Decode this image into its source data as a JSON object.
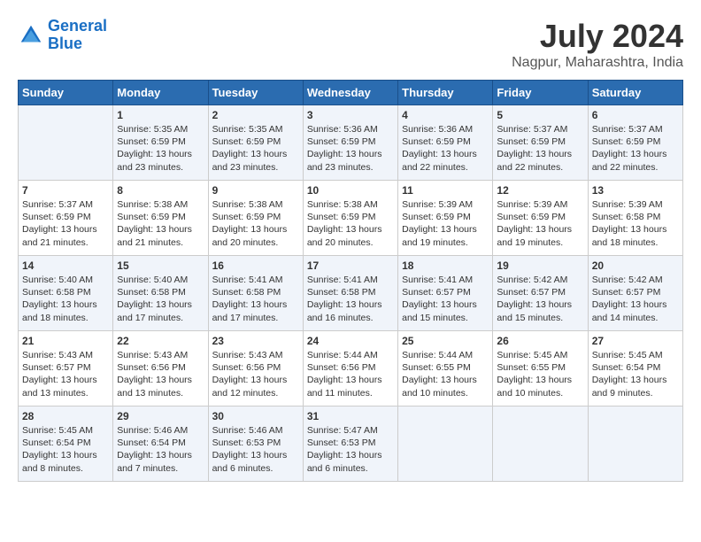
{
  "logo": {
    "line1": "General",
    "line2": "Blue"
  },
  "title": "July 2024",
  "location": "Nagpur, Maharashtra, India",
  "headers": [
    "Sunday",
    "Monday",
    "Tuesday",
    "Wednesday",
    "Thursday",
    "Friday",
    "Saturday"
  ],
  "weeks": [
    [
      {
        "day": "",
        "sunrise": "",
        "sunset": "",
        "daylight": ""
      },
      {
        "day": "1",
        "sunrise": "Sunrise: 5:35 AM",
        "sunset": "Sunset: 6:59 PM",
        "daylight": "Daylight: 13 hours and 23 minutes."
      },
      {
        "day": "2",
        "sunrise": "Sunrise: 5:35 AM",
        "sunset": "Sunset: 6:59 PM",
        "daylight": "Daylight: 13 hours and 23 minutes."
      },
      {
        "day": "3",
        "sunrise": "Sunrise: 5:36 AM",
        "sunset": "Sunset: 6:59 PM",
        "daylight": "Daylight: 13 hours and 23 minutes."
      },
      {
        "day": "4",
        "sunrise": "Sunrise: 5:36 AM",
        "sunset": "Sunset: 6:59 PM",
        "daylight": "Daylight: 13 hours and 22 minutes."
      },
      {
        "day": "5",
        "sunrise": "Sunrise: 5:37 AM",
        "sunset": "Sunset: 6:59 PM",
        "daylight": "Daylight: 13 hours and 22 minutes."
      },
      {
        "day": "6",
        "sunrise": "Sunrise: 5:37 AM",
        "sunset": "Sunset: 6:59 PM",
        "daylight": "Daylight: 13 hours and 22 minutes."
      }
    ],
    [
      {
        "day": "7",
        "sunrise": "Sunrise: 5:37 AM",
        "sunset": "Sunset: 6:59 PM",
        "daylight": "Daylight: 13 hours and 21 minutes."
      },
      {
        "day": "8",
        "sunrise": "Sunrise: 5:38 AM",
        "sunset": "Sunset: 6:59 PM",
        "daylight": "Daylight: 13 hours and 21 minutes."
      },
      {
        "day": "9",
        "sunrise": "Sunrise: 5:38 AM",
        "sunset": "Sunset: 6:59 PM",
        "daylight": "Daylight: 13 hours and 20 minutes."
      },
      {
        "day": "10",
        "sunrise": "Sunrise: 5:38 AM",
        "sunset": "Sunset: 6:59 PM",
        "daylight": "Daylight: 13 hours and 20 minutes."
      },
      {
        "day": "11",
        "sunrise": "Sunrise: 5:39 AM",
        "sunset": "Sunset: 6:59 PM",
        "daylight": "Daylight: 13 hours and 19 minutes."
      },
      {
        "day": "12",
        "sunrise": "Sunrise: 5:39 AM",
        "sunset": "Sunset: 6:59 PM",
        "daylight": "Daylight: 13 hours and 19 minutes."
      },
      {
        "day": "13",
        "sunrise": "Sunrise: 5:39 AM",
        "sunset": "Sunset: 6:58 PM",
        "daylight": "Daylight: 13 hours and 18 minutes."
      }
    ],
    [
      {
        "day": "14",
        "sunrise": "Sunrise: 5:40 AM",
        "sunset": "Sunset: 6:58 PM",
        "daylight": "Daylight: 13 hours and 18 minutes."
      },
      {
        "day": "15",
        "sunrise": "Sunrise: 5:40 AM",
        "sunset": "Sunset: 6:58 PM",
        "daylight": "Daylight: 13 hours and 17 minutes."
      },
      {
        "day": "16",
        "sunrise": "Sunrise: 5:41 AM",
        "sunset": "Sunset: 6:58 PM",
        "daylight": "Daylight: 13 hours and 17 minutes."
      },
      {
        "day": "17",
        "sunrise": "Sunrise: 5:41 AM",
        "sunset": "Sunset: 6:58 PM",
        "daylight": "Daylight: 13 hours and 16 minutes."
      },
      {
        "day": "18",
        "sunrise": "Sunrise: 5:41 AM",
        "sunset": "Sunset: 6:57 PM",
        "daylight": "Daylight: 13 hours and 15 minutes."
      },
      {
        "day": "19",
        "sunrise": "Sunrise: 5:42 AM",
        "sunset": "Sunset: 6:57 PM",
        "daylight": "Daylight: 13 hours and 15 minutes."
      },
      {
        "day": "20",
        "sunrise": "Sunrise: 5:42 AM",
        "sunset": "Sunset: 6:57 PM",
        "daylight": "Daylight: 13 hours and 14 minutes."
      }
    ],
    [
      {
        "day": "21",
        "sunrise": "Sunrise: 5:43 AM",
        "sunset": "Sunset: 6:57 PM",
        "daylight": "Daylight: 13 hours and 13 minutes."
      },
      {
        "day": "22",
        "sunrise": "Sunrise: 5:43 AM",
        "sunset": "Sunset: 6:56 PM",
        "daylight": "Daylight: 13 hours and 13 minutes."
      },
      {
        "day": "23",
        "sunrise": "Sunrise: 5:43 AM",
        "sunset": "Sunset: 6:56 PM",
        "daylight": "Daylight: 13 hours and 12 minutes."
      },
      {
        "day": "24",
        "sunrise": "Sunrise: 5:44 AM",
        "sunset": "Sunset: 6:56 PM",
        "daylight": "Daylight: 13 hours and 11 minutes."
      },
      {
        "day": "25",
        "sunrise": "Sunrise: 5:44 AM",
        "sunset": "Sunset: 6:55 PM",
        "daylight": "Daylight: 13 hours and 10 minutes."
      },
      {
        "day": "26",
        "sunrise": "Sunrise: 5:45 AM",
        "sunset": "Sunset: 6:55 PM",
        "daylight": "Daylight: 13 hours and 10 minutes."
      },
      {
        "day": "27",
        "sunrise": "Sunrise: 5:45 AM",
        "sunset": "Sunset: 6:54 PM",
        "daylight": "Daylight: 13 hours and 9 minutes."
      }
    ],
    [
      {
        "day": "28",
        "sunrise": "Sunrise: 5:45 AM",
        "sunset": "Sunset: 6:54 PM",
        "daylight": "Daylight: 13 hours and 8 minutes."
      },
      {
        "day": "29",
        "sunrise": "Sunrise: 5:46 AM",
        "sunset": "Sunset: 6:54 PM",
        "daylight": "Daylight: 13 hours and 7 minutes."
      },
      {
        "day": "30",
        "sunrise": "Sunrise: 5:46 AM",
        "sunset": "Sunset: 6:53 PM",
        "daylight": "Daylight: 13 hours and 6 minutes."
      },
      {
        "day": "31",
        "sunrise": "Sunrise: 5:47 AM",
        "sunset": "Sunset: 6:53 PM",
        "daylight": "Daylight: 13 hours and 6 minutes."
      },
      {
        "day": "",
        "sunrise": "",
        "sunset": "",
        "daylight": ""
      },
      {
        "day": "",
        "sunrise": "",
        "sunset": "",
        "daylight": ""
      },
      {
        "day": "",
        "sunrise": "",
        "sunset": "",
        "daylight": ""
      }
    ]
  ]
}
